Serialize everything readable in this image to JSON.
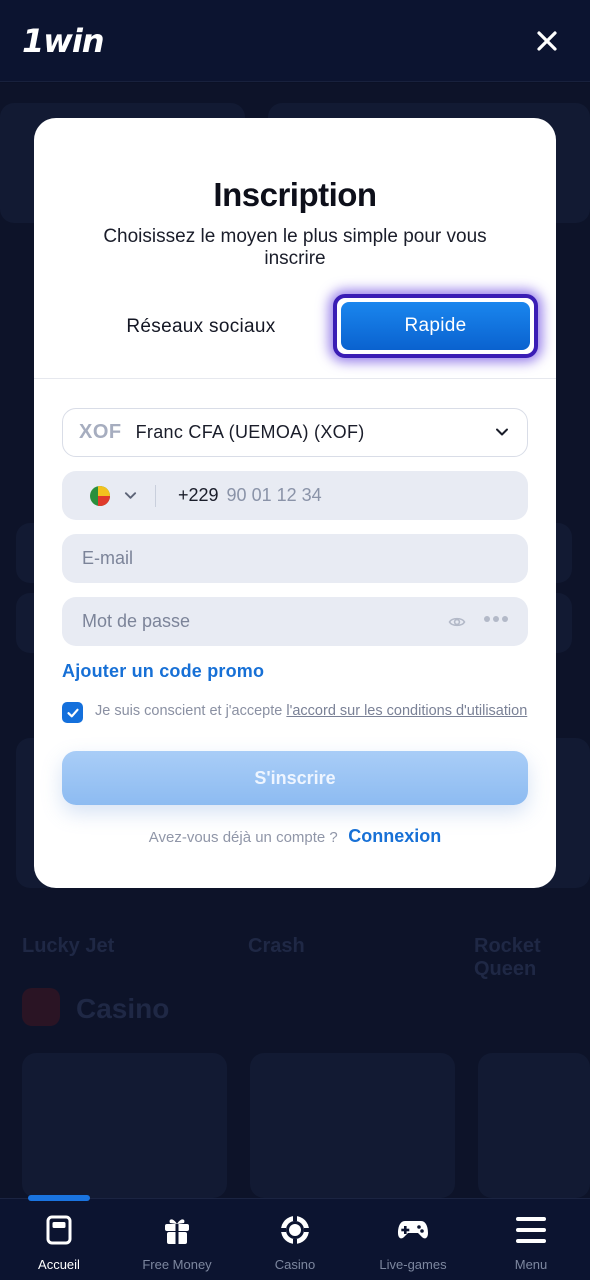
{
  "header": {
    "logo": "1win"
  },
  "modal": {
    "title": "Inscription",
    "subtitle": "Choisissez le moyen le plus simple pour vous inscrire",
    "tabs": {
      "social": "Réseaux sociaux",
      "rapide": "Rapide"
    },
    "currency": {
      "code": "XOF",
      "name": "Franc CFA (UEMOA) (XOF)"
    },
    "phone": {
      "code": "+229",
      "placeholder": "90 01 12 34"
    },
    "email": {
      "placeholder": "E-mail"
    },
    "password": {
      "placeholder": "Mot de passe"
    },
    "promo_link": "Ajouter un code promo",
    "terms": {
      "text": "Je suis conscient et j'accepte ",
      "link": "l'accord sur les conditions d'utilisation",
      "checked": true
    },
    "submit": "S'inscrire",
    "login": {
      "question": "Avez-vous déjà un compte ?",
      "link": "Connexion"
    }
  },
  "nav": {
    "items": [
      {
        "label": "Accueil",
        "icon": "home-icon",
        "active": true
      },
      {
        "label": "Free Money",
        "icon": "gift-icon"
      },
      {
        "label": "Casino",
        "icon": "casino-chip-icon"
      },
      {
        "label": "Live-games",
        "icon": "gamepad-icon"
      },
      {
        "label": "Menu",
        "icon": "menu-icon"
      }
    ]
  },
  "background": {
    "games": [
      "Lucky Jet",
      "Crash",
      "Rocket Queen"
    ],
    "section": "Casino"
  },
  "colors": {
    "primary": "#1770d6",
    "focus_ring": "#3a1db5",
    "bg": "#0b1126"
  }
}
